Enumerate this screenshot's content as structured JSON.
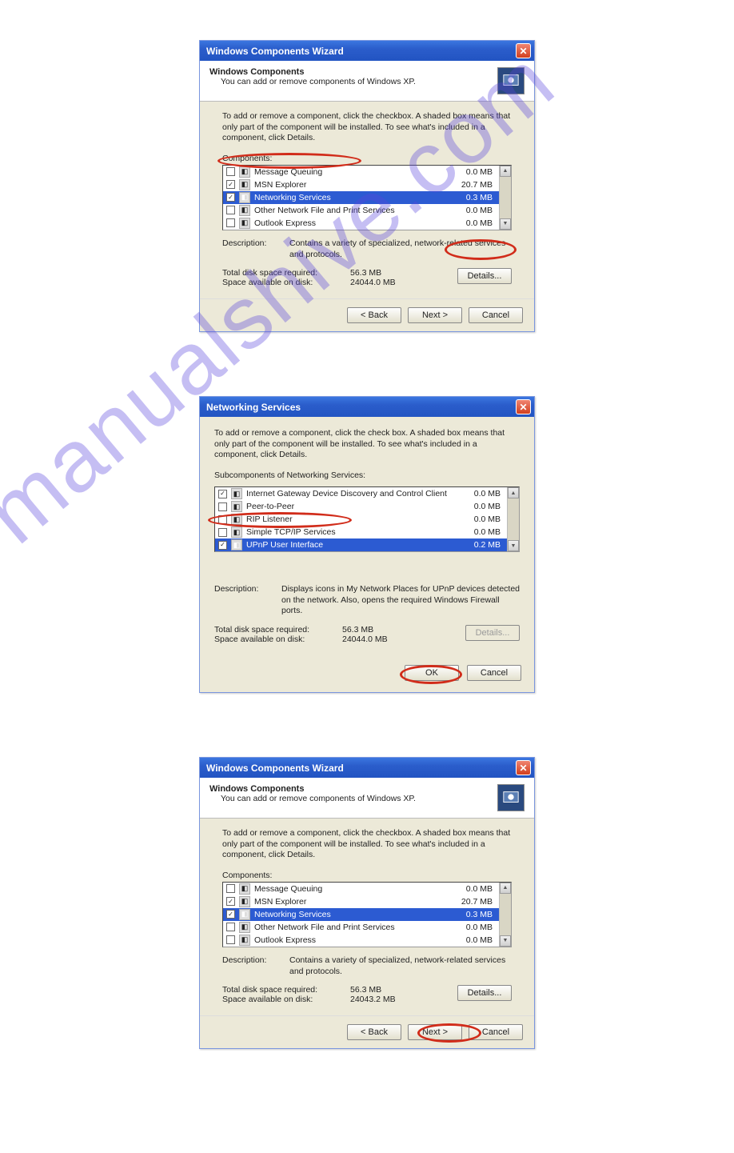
{
  "watermark": "manualshive.com",
  "dialog1": {
    "title": "Windows Components Wizard",
    "hdr_bold": "Windows Components",
    "hdr_sub": "You can add or remove components of Windows XP.",
    "instructions": "To add or remove a component, click the checkbox. A shaded box means that only part of the component will be installed. To see what's included in a component, click Details.",
    "components_label": "Components:",
    "rows": [
      {
        "name": "Message Queuing",
        "size": "0.0 MB",
        "checked": false
      },
      {
        "name": "MSN Explorer",
        "size": "20.7 MB",
        "checked": true
      },
      {
        "name": "Networking Services",
        "size": "0.3 MB",
        "checked": true,
        "selected": true
      },
      {
        "name": "Other Network File and Print Services",
        "size": "0.0 MB",
        "checked": false
      },
      {
        "name": "Outlook Express",
        "size": "0.0 MB",
        "checked": false
      }
    ],
    "desc_label": "Description:",
    "desc_text": "Contains a variety of specialized, network-related services and protocols.",
    "total_label": "Total disk space required:",
    "total_value": "56.3 MB",
    "avail_label": "Space available on disk:",
    "avail_value": "24044.0 MB",
    "details_btn": "Details...",
    "back_btn": "< Back",
    "next_btn": "Next >",
    "cancel_btn": "Cancel"
  },
  "dialog2": {
    "title": "Networking Services",
    "instructions": "To add or remove a component, click the check box. A shaded box means that only part of the component will be installed. To see what's included in a component, click Details.",
    "sub_label": "Subcomponents of Networking Services:",
    "rows": [
      {
        "name": "Internet Gateway Device Discovery and Control Client",
        "size": "0.0 MB",
        "checked": true
      },
      {
        "name": "Peer-to-Peer",
        "size": "0.0 MB",
        "checked": false
      },
      {
        "name": "RIP Listener",
        "size": "0.0 MB",
        "checked": false
      },
      {
        "name": "Simple TCP/IP Services",
        "size": "0.0 MB",
        "checked": false
      },
      {
        "name": "UPnP User Interface",
        "size": "0.2 MB",
        "checked": true,
        "selected": true
      }
    ],
    "desc_label": "Description:",
    "desc_text": "Displays icons in My Network Places for UPnP devices detected on the network. Also, opens the required Windows Firewall ports.",
    "total_label": "Total disk space required:",
    "total_value": "56.3 MB",
    "avail_label": "Space available on disk:",
    "avail_value": "24044.0 MB",
    "details_btn": "Details...",
    "ok_btn": "OK",
    "cancel_btn": "Cancel"
  },
  "dialog3": {
    "title": "Windows Components Wizard",
    "hdr_bold": "Windows Components",
    "hdr_sub": "You can add or remove components of Windows XP.",
    "instructions": "To add or remove a component, click the checkbox. A shaded box means that only part of the component will be installed. To see what's included in a component, click Details.",
    "components_label": "Components:",
    "rows": [
      {
        "name": "Message Queuing",
        "size": "0.0 MB",
        "checked": false
      },
      {
        "name": "MSN Explorer",
        "size": "20.7 MB",
        "checked": true
      },
      {
        "name": "Networking Services",
        "size": "0.3 MB",
        "checked": true,
        "selected": true
      },
      {
        "name": "Other Network File and Print Services",
        "size": "0.0 MB",
        "checked": false
      },
      {
        "name": "Outlook Express",
        "size": "0.0 MB",
        "checked": false
      }
    ],
    "desc_label": "Description:",
    "desc_text": "Contains a variety of specialized, network-related services and protocols.",
    "total_label": "Total disk space required:",
    "total_value": "56.3 MB",
    "avail_label": "Space available on disk:",
    "avail_value": "24043.2 MB",
    "details_btn": "Details...",
    "back_btn": "< Back",
    "next_btn": "Next >",
    "cancel_btn": "Cancel"
  }
}
